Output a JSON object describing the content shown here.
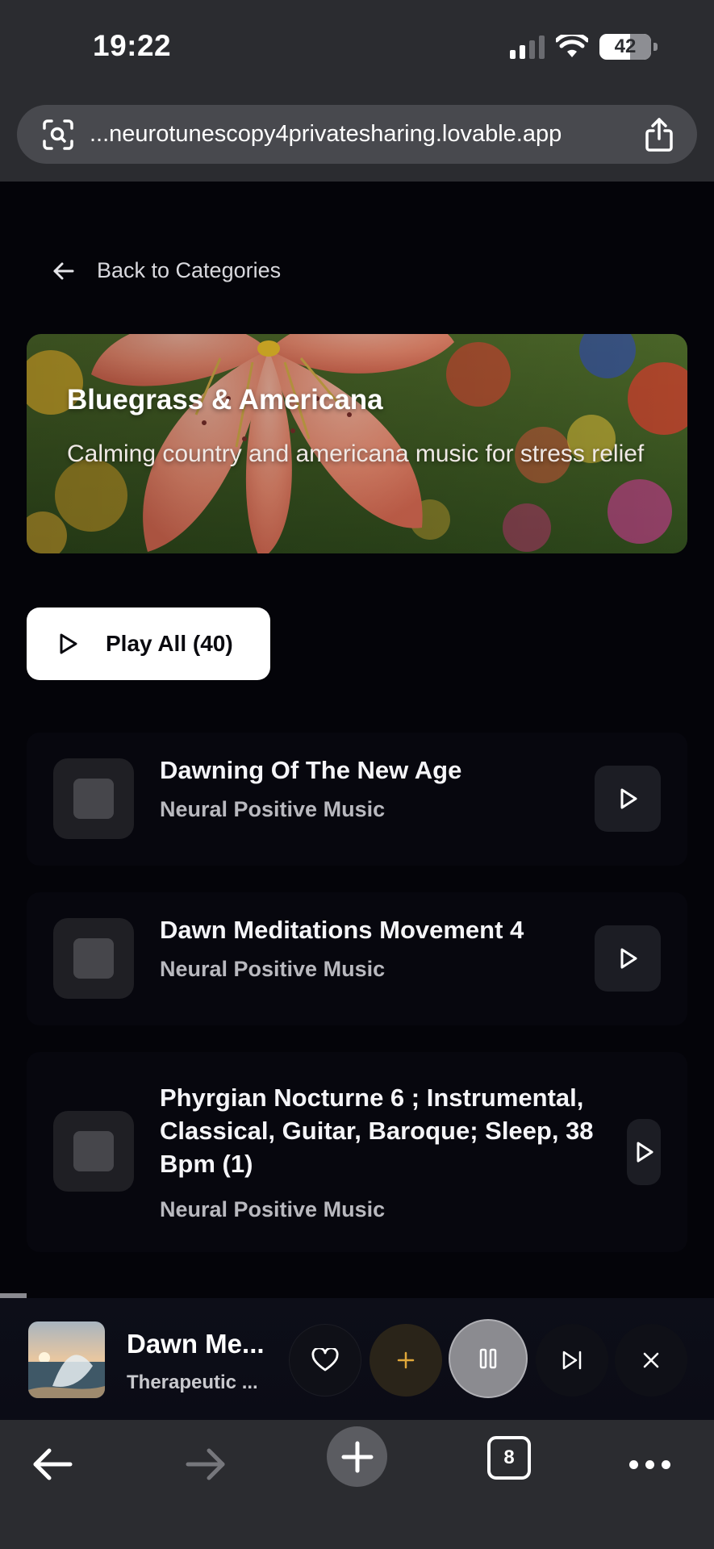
{
  "status_bar": {
    "time": "19:22",
    "battery": "42"
  },
  "browser": {
    "url": "...neurotunescopy4privatesharing.lovable.app",
    "tab_count": "8"
  },
  "nav": {
    "back_label": "Back to Categories"
  },
  "category": {
    "title": "Bluegrass & Americana",
    "description": "Calming country and americana music for stress relief"
  },
  "play_all": {
    "label": "Play All (40)"
  },
  "tracks": [
    {
      "title": "Dawning Of The New Age",
      "artist": "Neural Positive Music"
    },
    {
      "title": "Dawn Meditations Movement 4",
      "artist": "Neural Positive Music"
    },
    {
      "title": "Phyrgian Nocturne 6 ; Instrumental, Classical, Guitar, Baroque; Sleep, 38 Bpm (1)",
      "artist": "Neural Positive Music"
    }
  ],
  "now_playing": {
    "title": "Dawn Me...",
    "artist": "Therapeutic ...",
    "progress": 0.037
  },
  "colors": {
    "background": "#040409",
    "card": "#07070e",
    "accent_add": "#e0a83a",
    "browser_chrome": "#2b2c30"
  },
  "icons": [
    "arrow-left-icon",
    "play-icon",
    "heart-icon",
    "plus-icon",
    "pause-icon",
    "skip-next-icon",
    "close-icon",
    "share-icon",
    "lens-icon",
    "more-icon"
  ]
}
